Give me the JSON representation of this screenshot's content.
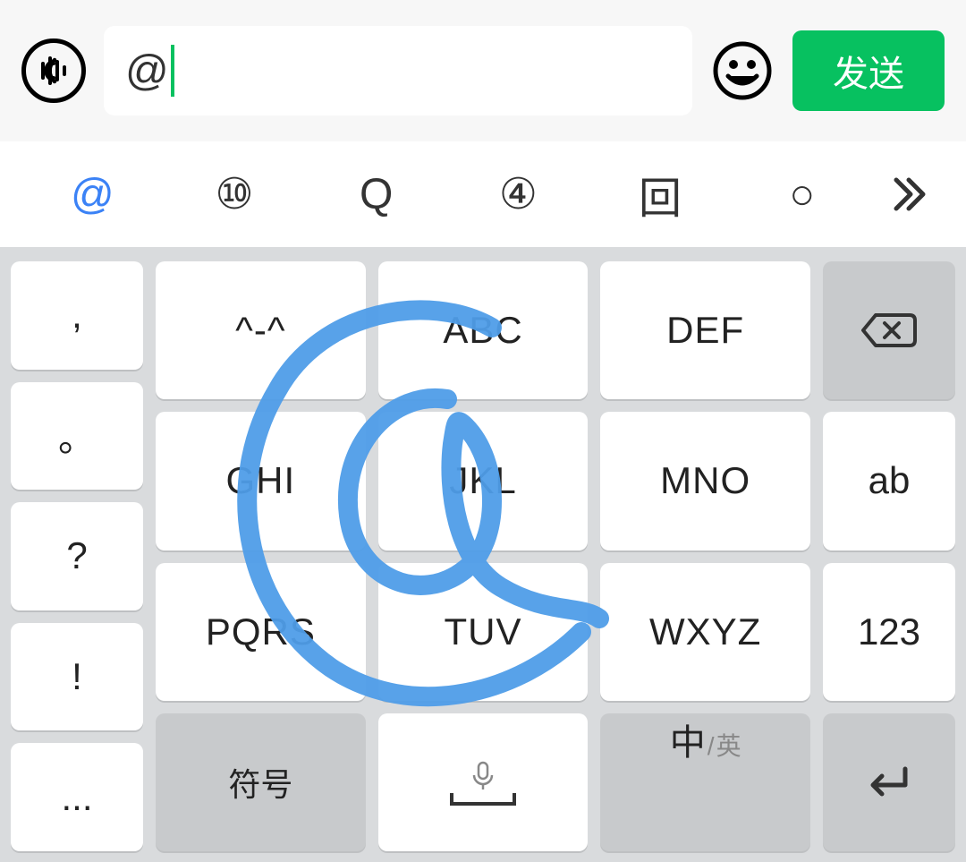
{
  "input_bar": {
    "value": "@",
    "send_label": "发送"
  },
  "candidates": {
    "items": [
      "@",
      "⑩",
      "Q",
      "④",
      "回",
      "○"
    ],
    "active_index": 0
  },
  "keyboard": {
    "left_column": [
      ",",
      "。",
      "?",
      "!",
      "..."
    ],
    "grid": [
      [
        "^-^",
        "ABC",
        "DEF"
      ],
      [
        "GHI",
        "JKL",
        "MNO"
      ],
      [
        "PQRS",
        "TUV",
        "WXYZ"
      ]
    ],
    "bottom_mid": {
      "symbol_label": "符号",
      "lang_main": "中",
      "lang_sep": "/",
      "lang_sub": "英"
    },
    "right_column": {
      "ab_label": "ab",
      "num_label": "123"
    }
  }
}
